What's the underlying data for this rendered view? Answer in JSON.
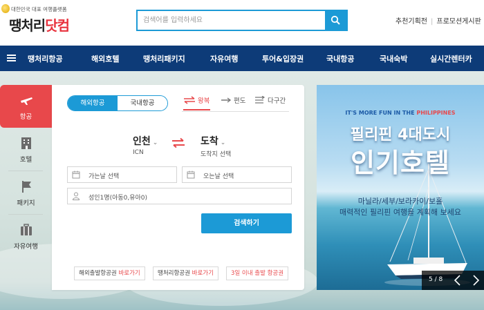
{
  "header": {
    "logo_sub": "대한민국 대표 여행플랫폼",
    "logo_main": "땡처리",
    "logo_accent": "닷컴",
    "search": {
      "placeholder": "검색어를 입력하세요"
    },
    "links": [
      "추천기획전",
      "프로모션게시판"
    ]
  },
  "nav": {
    "items": [
      "땡처리항공",
      "해외호텔",
      "땡처리패키지",
      "자유여행",
      "투어&입장권",
      "국내항공",
      "국내숙박",
      "실시간렌터카"
    ]
  },
  "side_tabs": [
    {
      "label": "항공",
      "icon": "airplane-icon",
      "active": true
    },
    {
      "label": "호텔",
      "icon": "hotel-building-icon",
      "active": false
    },
    {
      "label": "패키지",
      "icon": "flag-icon",
      "active": false
    },
    {
      "label": "자유여행",
      "icon": "suitcase-icon",
      "active": false
    }
  ],
  "booking": {
    "scope_tabs": [
      "해외항공",
      "국내항공"
    ],
    "trip_types": [
      "왕복",
      "편도",
      "다구간"
    ],
    "origin": {
      "city": "인천",
      "code": "ICN"
    },
    "destination": {
      "city": "도착",
      "code": "도착지 선택"
    },
    "depart_date_placeholder": "가는날 선택",
    "return_date_placeholder": "오는날 선택",
    "passengers": "성인1명(아동0,유아0)",
    "search_label": "검색하기",
    "quick_links": [
      {
        "text": "해외출발항공권",
        "go": "바로가기"
      },
      {
        "text": "땡처리항공권",
        "go": "바로가기"
      },
      {
        "text": "3일 이내 출발 항공권",
        "go": ""
      }
    ]
  },
  "banner": {
    "tag_a": "IT'S MORE FUN IN THE ",
    "tag_b": "PHILIPPINES",
    "title_1": "필리핀 4대도시",
    "title_2": "인기호텔",
    "sub_1": "마닐라/세부/보라카이/보홀",
    "sub_2": "매력적인 필리핀 여행을 계획해 보세요",
    "pager": "5 / 8"
  },
  "colors": {
    "brand_blue": "#1c9ad6",
    "nav_navy": "#0d3b78",
    "accent_red": "#e8484b"
  }
}
